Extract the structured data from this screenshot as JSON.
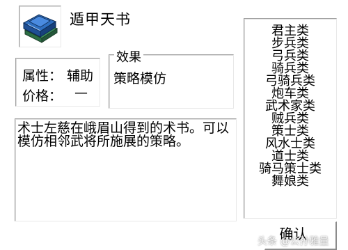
{
  "item": {
    "icon": "blue-book-icon",
    "name": "遁甲天书"
  },
  "stats": {
    "attribute_label": "属性：",
    "attribute_value": "辅助",
    "price_label": "价格：",
    "price_value": "—"
  },
  "effect": {
    "title": "效果",
    "text": "策略模仿"
  },
  "description": "术士左慈在峨眉山得到的术书。可以模仿相邻武将所施展的策略。",
  "classes": [
    "君主类",
    "步兵类",
    "弓兵类",
    "骑兵类",
    "弓骑兵类",
    "炮车类",
    "武术家类",
    "贼兵类",
    "策士类",
    "风水士类",
    "道士类",
    "骑马策士类",
    "舞娘类"
  ],
  "buttons": {
    "confirm": "确认"
  },
  "watermark": "头条 @公孙雅量",
  "colors": {
    "book_cover": "#2f6fc0",
    "book_pages": "#3a8f5a"
  }
}
